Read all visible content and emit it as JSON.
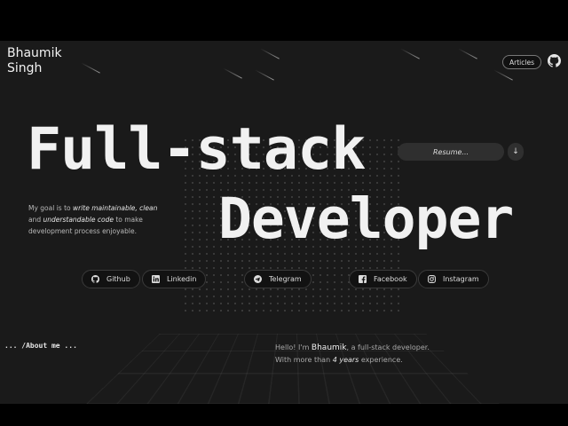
{
  "header": {
    "brand": "Bhaumik\nSingh",
    "articles_label": "Articles",
    "github_icon": "github-icon"
  },
  "hero": {
    "line1": "Full-stack",
    "line2": "Developer",
    "resume_label": "Resume...",
    "download_glyph": "↓"
  },
  "goal": {
    "prefix": "My goal is to ",
    "em1": "write maintainable, clean",
    "mid": " and ",
    "em2": "understandable code",
    "suffix": " to make development process enjoyable."
  },
  "socials": [
    {
      "label": "Github",
      "icon": "github-icon"
    },
    {
      "label": "Linkedin",
      "icon": "linkedin-icon"
    },
    {
      "label": "Telegram",
      "icon": "telegram-icon"
    },
    {
      "label": "Facebook",
      "icon": "facebook-icon"
    },
    {
      "label": "Instagram",
      "icon": "instagram-icon"
    }
  ],
  "about": {
    "heading": "... /About me ...",
    "hello_prefix": "Hello! I'm ",
    "name": "Bhaumik",
    "hello_suffix": ", a full-stack developer.",
    "exp_prefix": "With more than ",
    "exp_em": "4 years",
    "exp_suffix": " experience."
  }
}
